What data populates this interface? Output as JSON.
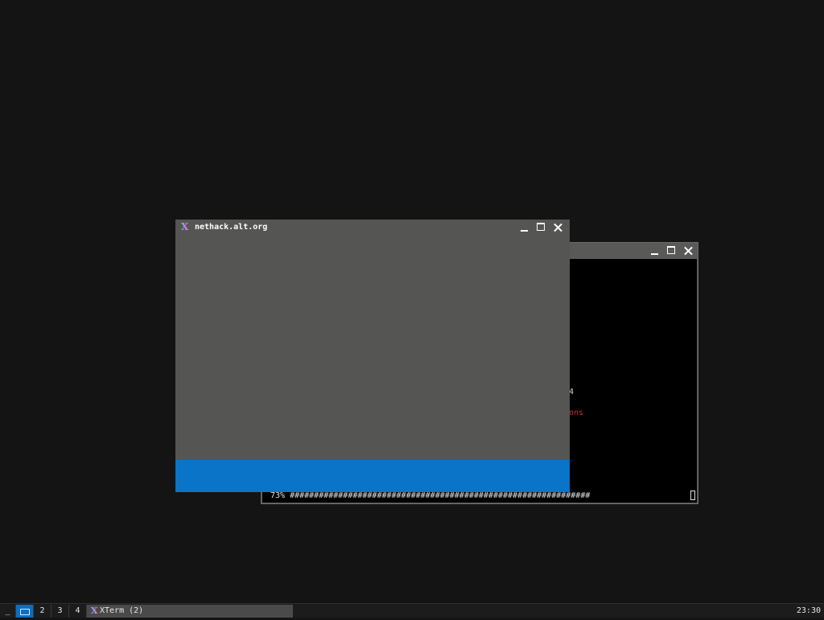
{
  "xterm": {
    "progress_text": "73% ##############################################################",
    "line_fragment_1": "4",
    "line_fragment_2": "ons"
  },
  "nethack_window": {
    "title": "nethack.alt.org",
    "icon": "xterm-x-icon"
  },
  "taskbar": {
    "menu_label": "_",
    "workspaces": [
      "",
      "2",
      "3",
      "4"
    ],
    "active_workspace": 1,
    "task_label": "XTerm (2)",
    "clock": "23:30"
  },
  "colors": {
    "desktop": "#141414",
    "window_gray": "#555653",
    "accent_blue": "#0a74c8",
    "terminal_red": "#d0273a"
  }
}
